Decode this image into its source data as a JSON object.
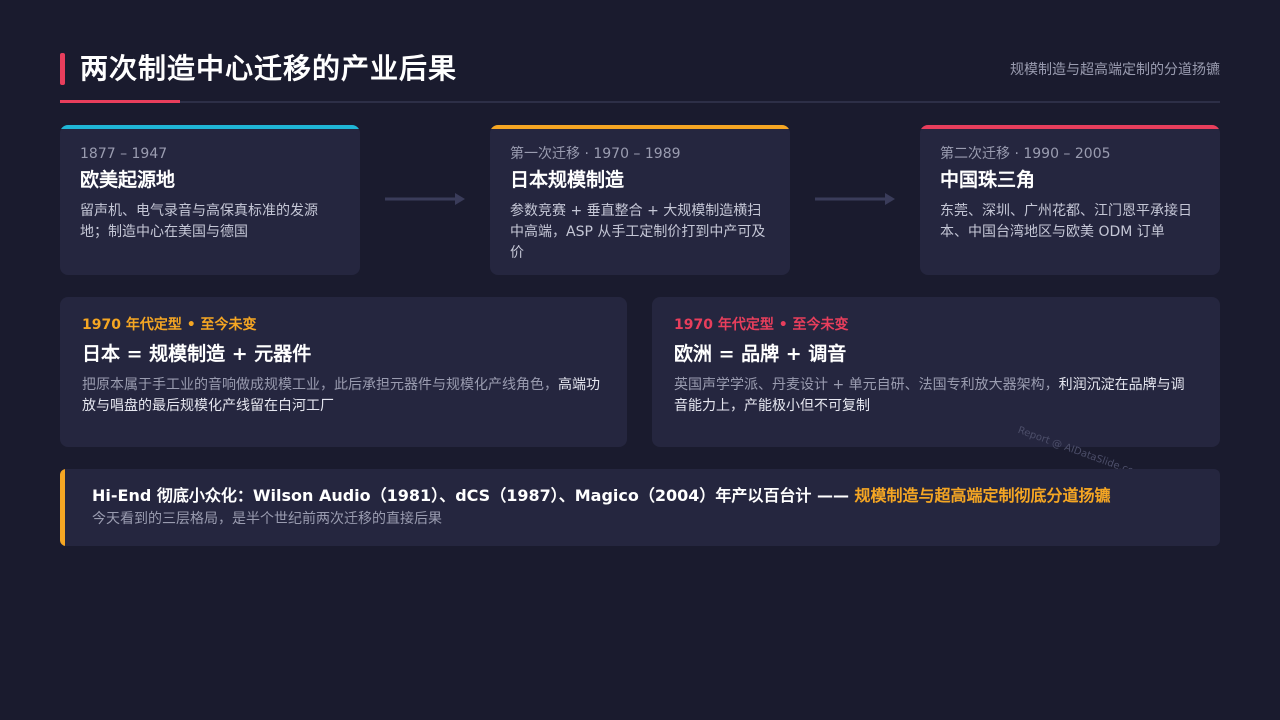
{
  "header": {
    "title": "两次制造中心迁移的产业后果",
    "subtitle": "规模制造与超高端定制的分道扬镳"
  },
  "timeline": [
    {
      "period": "1877 – 1947",
      "name": "欧美起源地",
      "desc": "留声机、电气录音与高保真标准的发源地；制造中心在美国与德国",
      "color": "#1fb6d6"
    },
    {
      "period": "第一次迁移 · 1970 – 1989",
      "name": "日本规模制造",
      "desc": "参数竞赛 + 垂直整合 + 大规模制造横扫中高端，ASP 从手工定制价打到中产可及价",
      "color": "#f5a623"
    },
    {
      "period": "第二次迁移 · 1990 – 2005",
      "name": "中国珠三角",
      "desc": "东莞、深圳、广州花都、江门恩平承接日本、中国台湾地区与欧美 ODM 订单",
      "color": "#e83e5c"
    }
  ],
  "cards": {
    "japan": {
      "tag": "1970 年代定型 • 至今未变",
      "headline": "日本 = 规模制造 + 元器件",
      "body_plain": "把原本属于手工业的音响做成规模工业，此后承担元器件与规模化产线角色，",
      "body_hl": "高端功放与唱盘的最后规模化产线留在白河工厂",
      "tag_color": "#f5a623"
    },
    "europe": {
      "tag": "1970 年代定型 • 至今未变",
      "headline": "欧洲 = 品牌 + 调音",
      "body_plain": "英国声学学派、丹麦设计 + 单元自研、法国专利放大器架构，",
      "body_hl": "利润沉淀在品牌与调音能力上，产能极小但不可复制",
      "tag_color": "#e83e5c"
    }
  },
  "watermark": "Report @ AIDataSlide.com",
  "banner": {
    "main": "Hi-End 彻底小众化：Wilson Audio（1981）、dCS（1987）、Magico（2004）年产以百台计 —— ",
    "highlight": "规模制造与超高端定制彻底分道扬镳",
    "sub": "今天看到的三层格局，是半个世纪前两次迁移的直接后果"
  }
}
